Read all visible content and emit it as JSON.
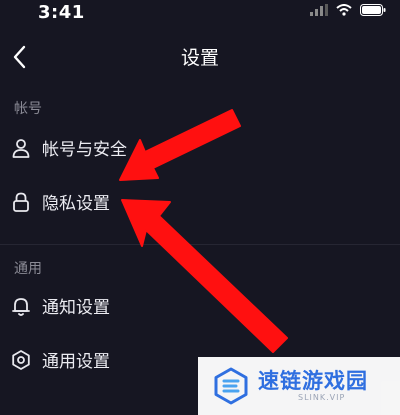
{
  "status_bar": {
    "time": "3:41",
    "icons": [
      "signal-icon",
      "wifi-icon",
      "battery-icon"
    ]
  },
  "nav": {
    "title": "设置",
    "back_icon": "chevron-left-icon"
  },
  "sections": [
    {
      "label": "帐号",
      "items": [
        {
          "label": "帐号与安全",
          "icon": "user-icon"
        },
        {
          "label": "隐私设置",
          "icon": "lock-icon"
        }
      ]
    },
    {
      "label": "通用",
      "items": [
        {
          "label": "通知设置",
          "icon": "bell-icon"
        },
        {
          "label": "通用设置",
          "icon": "gear-icon"
        }
      ]
    }
  ],
  "annotation": {
    "arrow_color": "#ff1010"
  },
  "watermark": {
    "title": "速链游戏园",
    "subtitle": "SLINK.VIP",
    "brand_color": "#2f6fe0"
  }
}
